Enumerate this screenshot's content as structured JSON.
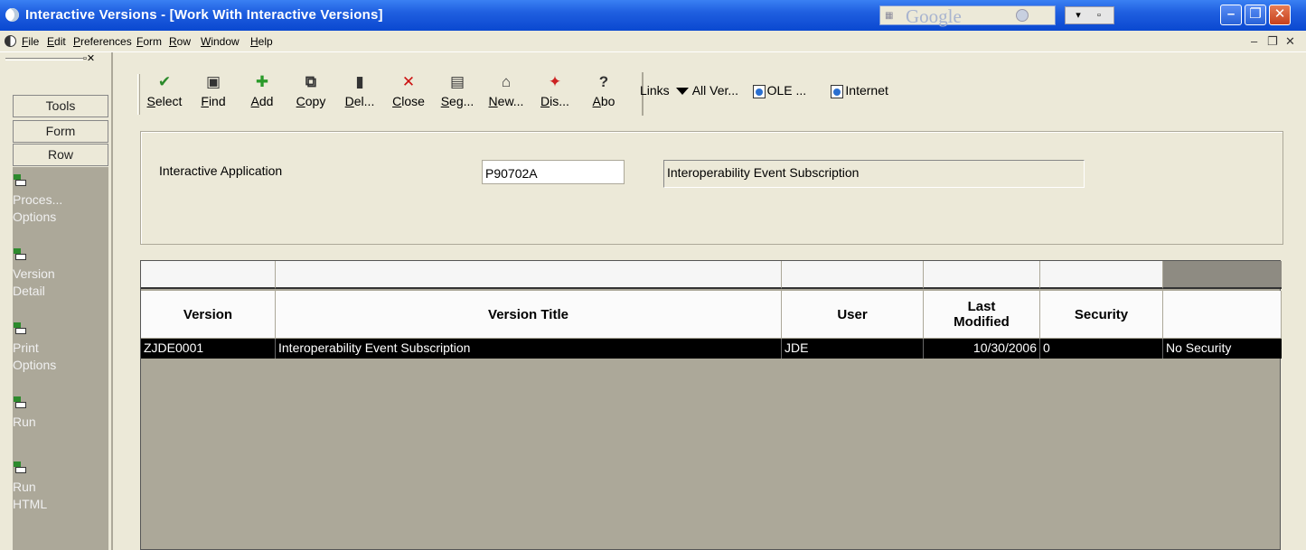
{
  "window": {
    "title": "Interactive Versions - [Work With Interactive Versions]",
    "google_text": "Google"
  },
  "menu": {
    "items": [
      "File",
      "Edit",
      "Preferences",
      "Form",
      "Row",
      "Window",
      "Help"
    ]
  },
  "left_panel": {
    "tabs": [
      "Tools",
      "Form",
      "Row"
    ],
    "row_items": [
      {
        "line1": "Proces...",
        "line2": "Options"
      },
      {
        "line1": "Version",
        "line2": "Detail"
      },
      {
        "line1": "Print",
        "line2": "Options"
      },
      {
        "line1": "Run",
        "line2": ""
      },
      {
        "line1": "Run",
        "line2": "HTML"
      }
    ]
  },
  "toolbar": {
    "buttons": [
      {
        "label": "Select",
        "icon": "check-icon",
        "glyph": "✔",
        "color": "#2a8a2a"
      },
      {
        "label": "Find",
        "icon": "find-icon",
        "glyph": "▣",
        "color": "#333333"
      },
      {
        "label": "Add",
        "icon": "plus-icon",
        "glyph": "✚",
        "color": "#2a9a2a"
      },
      {
        "label": "Copy",
        "icon": "copy-icon",
        "glyph": "⧉",
        "color": "#333333"
      },
      {
        "label": "Del...",
        "icon": "trash-icon",
        "glyph": "▮",
        "color": "#333333"
      },
      {
        "label": "Close",
        "icon": "close-icon",
        "glyph": "✕",
        "color": "#cc1111"
      },
      {
        "label": "Seg...",
        "icon": "segment-icon",
        "glyph": "▤",
        "color": "#333333"
      },
      {
        "label": "New...",
        "icon": "new-icon",
        "glyph": "⌂",
        "color": "#333333"
      },
      {
        "label": "Dis...",
        "icon": "display-icon",
        "glyph": "✦",
        "color": "#cc2222"
      },
      {
        "label": "Abo",
        "icon": "about-icon",
        "glyph": "?",
        "color": "#333333"
      }
    ],
    "links_label": "Links",
    "all_versions": "All Ver...",
    "ole": "OLE ...",
    "internet": "Internet"
  },
  "form": {
    "app_label": "Interactive Application",
    "app_code": "P90702A",
    "app_description": "Interoperability Event Subscription"
  },
  "grid": {
    "headers": [
      "Version",
      "Version Title",
      "User",
      "Last Modified",
      "Security",
      ""
    ],
    "rows": [
      [
        "ZJDE0001",
        "Interoperability Event Subscription",
        "JDE",
        "10/30/2006",
        "0",
        "No Security"
      ]
    ]
  }
}
